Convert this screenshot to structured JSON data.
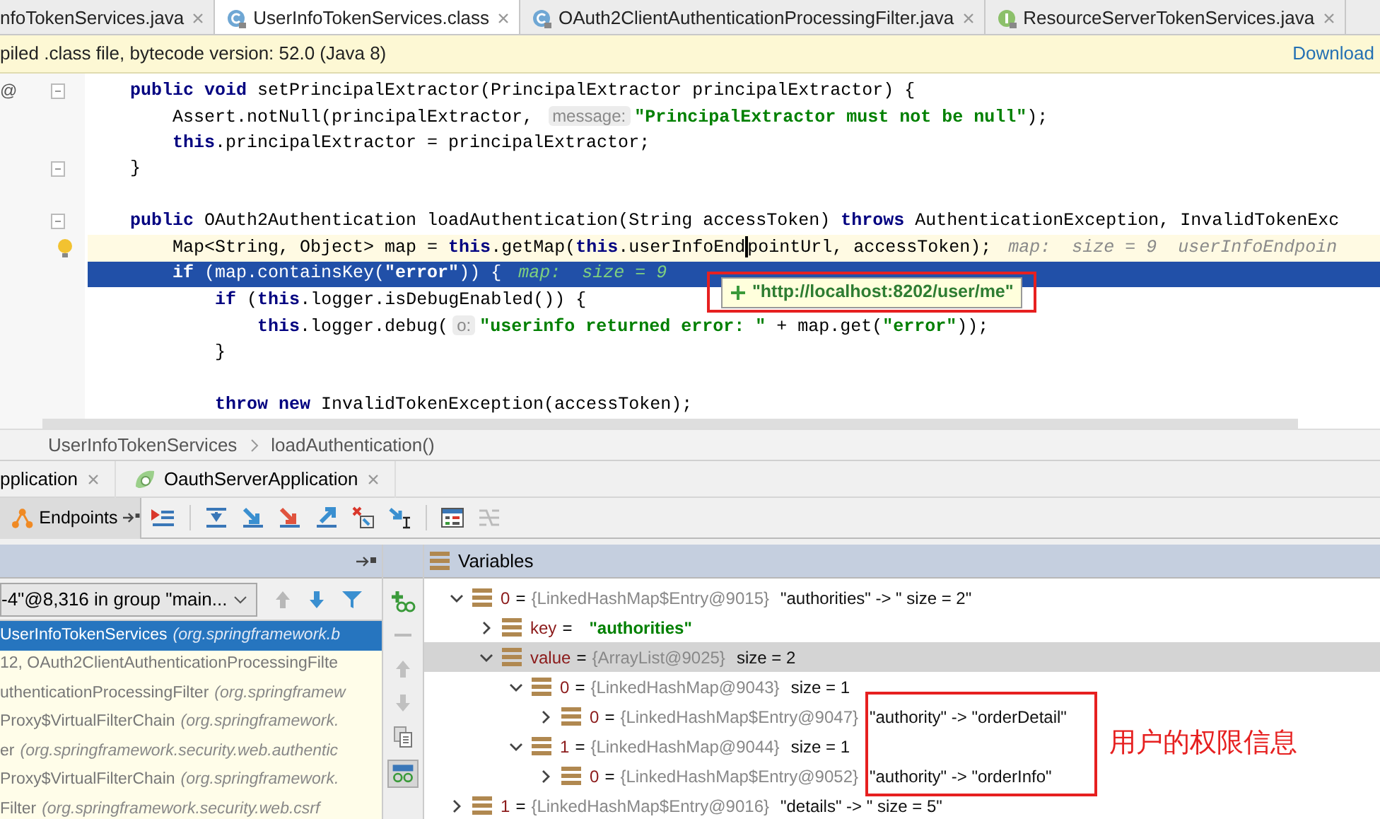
{
  "editor_tabs": [
    {
      "label": "nfoTokenServices.java",
      "kind": "none",
      "selected": false
    },
    {
      "label": "UserInfoTokenServices.class",
      "kind": "class",
      "selected": true
    },
    {
      "label": "OAuth2ClientAuthenticationProcessingFilter.java",
      "kind": "class",
      "selected": false
    },
    {
      "label": "ResourceServerTokenServices.java",
      "kind": "interface",
      "selected": false
    }
  ],
  "banner": {
    "text": "piled .class file, bytecode version: 52.0 (Java 8)",
    "link": "Download"
  },
  "code_lines": [
    {
      "kind": "normal",
      "gutter_text": "@",
      "fold": true,
      "tokens": [
        {
          "kind": "kw",
          "text": "    public void "
        },
        {
          "kind": "plain",
          "text": "setPrincipalExtractor(PrincipalExtractor principalExtractor) {"
        }
      ]
    },
    {
      "kind": "normal",
      "tokens": [
        {
          "kind": "plain",
          "text": "        Assert.notNull(principalExtractor, "
        },
        {
          "kind": "hint",
          "text": "message:"
        },
        {
          "kind": "str",
          "text": "\"PrincipalExtractor must not be null\""
        },
        {
          "kind": "plain",
          "text": ");"
        }
      ]
    },
    {
      "kind": "normal",
      "tokens": [
        {
          "kind": "kw",
          "text": "        this"
        },
        {
          "kind": "plain",
          "text": ".principalExtractor = principalExtractor;"
        }
      ]
    },
    {
      "kind": "normal",
      "fold": true,
      "tokens": [
        {
          "kind": "plain",
          "text": "    }"
        }
      ]
    },
    {
      "kind": "normal"
    },
    {
      "kind": "normal",
      "fold": true,
      "tokens": [
        {
          "kind": "kw",
          "text": "    public "
        },
        {
          "kind": "plain",
          "text": "OAuth2Authentication loadAuthentication(String accessToken) "
        },
        {
          "kind": "kw",
          "text": "throws "
        },
        {
          "kind": "plain",
          "text": "AuthenticationException, InvalidTokenExc"
        }
      ]
    },
    {
      "kind": "caret",
      "lightbulb": true,
      "tokens": [
        {
          "kind": "plain",
          "text": "        Map<String, Object> map = "
        },
        {
          "kind": "kw",
          "text": "this"
        },
        {
          "kind": "plain",
          "text": ".getMap("
        },
        {
          "kind": "kw",
          "text": "this"
        },
        {
          "kind": "plain",
          "text": ".userInfoEnd"
        },
        {
          "kind": "caret"
        },
        {
          "kind": "plain",
          "text": "pointUrl, accessToken);"
        },
        {
          "kind": "inline",
          "text": "map:  size = 9  userInfoEndpoin"
        }
      ]
    },
    {
      "kind": "execution",
      "tokens": [
        {
          "kind": "kw",
          "text": "        if"
        },
        {
          "kind": "plain",
          "text": " (map.containsKey("
        },
        {
          "kind": "str",
          "text": "\"error\""
        },
        {
          "kind": "plain",
          "text": ")) {"
        },
        {
          "kind": "inline",
          "text": "map:  size = 9"
        }
      ]
    },
    {
      "kind": "normal",
      "tokens": [
        {
          "kind": "kw",
          "text": "            if"
        },
        {
          "kind": "plain",
          "text": " ("
        },
        {
          "kind": "kw",
          "text": "this"
        },
        {
          "kind": "plain",
          "text": ".logger.isDebugEnabled()) {"
        }
      ]
    },
    {
      "kind": "normal",
      "tokens": [
        {
          "kind": "kw",
          "text": "                this"
        },
        {
          "kind": "plain",
          "text": ".logger.debug("
        },
        {
          "kind": "hint",
          "text": "o:"
        },
        {
          "kind": "str",
          "text": "\"userinfo returned error: \""
        },
        {
          "kind": "plain",
          "text": " + map.get("
        },
        {
          "kind": "str",
          "text": "\"error\""
        },
        {
          "kind": "plain",
          "text": "));"
        }
      ]
    },
    {
      "kind": "normal",
      "tokens": [
        {
          "kind": "plain",
          "text": "            }"
        }
      ]
    },
    {
      "kind": "normal"
    },
    {
      "kind": "normal",
      "tokens": [
        {
          "kind": "kw",
          "text": "            throw new "
        },
        {
          "kind": "plain",
          "text": "InvalidTokenException(accessToken);"
        }
      ]
    }
  ],
  "tooltip": {
    "text": "\"http://localhost:8202/user/me\"",
    "boxed": true
  },
  "breadcrumb": [
    "UserInfoTokenServices",
    "loadAuthentication()"
  ],
  "run_tabs": [
    {
      "label": "pplication"
    },
    {
      "label": "OauthServerApplication"
    }
  ],
  "endpoints_button": "Endpoints",
  "frames": {
    "thread": "-4\"@8,316 in group \"main...",
    "rows": [
      {
        "method": "UserInfoTokenServices",
        "location": "(org.springframework.b",
        "selected": true
      },
      {
        "method": "12, OAuth2ClientAuthenticationProcessingFilte",
        "selected": false
      },
      {
        "method": "uthenticationProcessingFilter",
        "location": "(org.springframew",
        "selected": false
      },
      {
        "method": "Proxy$VirtualFilterChain",
        "location": "(org.springframework.",
        "selected": false
      },
      {
        "method": "er",
        "location": "(org.springframework.security.web.authentic",
        "selected": false
      },
      {
        "method": "Proxy$VirtualFilterChain",
        "location": "(org.springframework.",
        "selected": false
      },
      {
        "method": "Filter",
        "location": "(org.springframework.security.web.csrf",
        "selected": false
      }
    ]
  },
  "variables": {
    "title": "Variables",
    "tree": [
      {
        "name": "0",
        "sep": "=",
        "type": "{LinkedHashMap$Entry@9015}",
        "value": "\"authorities\" -> \" size = 2\"",
        "kind": "plain",
        "expanded": true,
        "selected": false,
        "children": [
          {
            "name": "key",
            "sep": "=",
            "value": "\"authorities\"",
            "kind": "string",
            "expanded": false,
            "selected": false
          },
          {
            "name": "value",
            "sep": "=",
            "type": "{ArrayList@9025}",
            "value": "size = 2",
            "kind": "plain",
            "expanded": true,
            "selected": true,
            "children": [
              {
                "name": "0",
                "sep": "=",
                "type": "{LinkedHashMap@9043}",
                "value": "size = 1",
                "kind": "plain",
                "expanded": true,
                "selected": false,
                "children": [
                  {
                    "name": "0",
                    "sep": "=",
                    "type": "{LinkedHashMap$Entry@9047}",
                    "value": "\"authority\" -> \"orderDetail\"",
                    "kind": "plain",
                    "expanded": false,
                    "selected": false,
                    "boxed": true
                  }
                ]
              },
              {
                "name": "1",
                "sep": "=",
                "type": "{LinkedHashMap@9044}",
                "value": "size = 1",
                "kind": "plain",
                "expanded": true,
                "selected": false,
                "children": [
                  {
                    "name": "0",
                    "sep": "=",
                    "type": "{LinkedHashMap$Entry@9052}",
                    "value": "\"authority\" -> \"orderInfo\"",
                    "kind": "plain",
                    "expanded": false,
                    "selected": false,
                    "boxed": true
                  }
                ]
              }
            ]
          }
        ]
      },
      {
        "name": "1",
        "sep": "=",
        "type": "{LinkedHashMap$Entry@9016}",
        "value": "\"details\" -> \" size = 5\"",
        "kind": "plain",
        "expanded": false,
        "selected": false
      }
    ]
  },
  "annotation": {
    "text": "用户的权限信息"
  }
}
